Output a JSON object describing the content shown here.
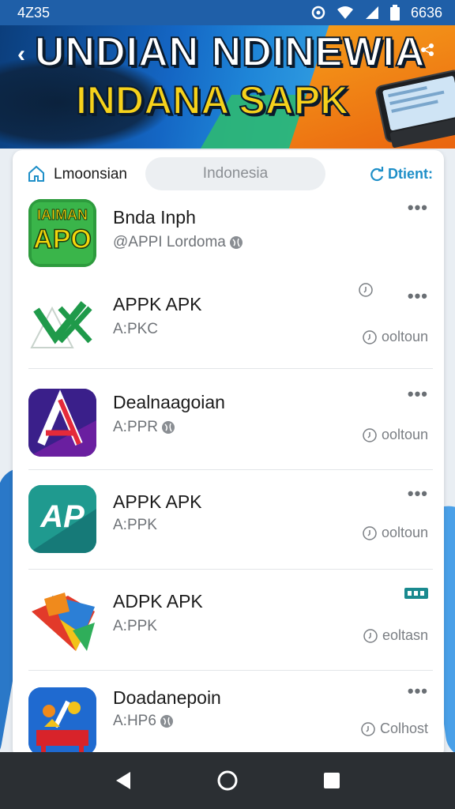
{
  "status_bar": {
    "time": "4Z35",
    "battery_text": "6636"
  },
  "banner": {
    "title_line1": "UNDIAN NDINEWIA",
    "title_line2": "INDANA SAPK"
  },
  "header": {
    "home_label": "Lmoonsian",
    "search_placeholder": "Indonesia",
    "right_label": "Dtient:"
  },
  "apps": [
    {
      "name": "Bnda Inph",
      "sub": "@APPI Lordoma",
      "meta": "",
      "icon_text_top": "IAIMAN",
      "icon_text_bottom": "APO"
    },
    {
      "name": "APPK APK",
      "sub": "A:PKC",
      "meta": "ooltoun"
    },
    {
      "name": "Dealnaagoian",
      "sub": "A:PPR",
      "meta": "ooltoun"
    },
    {
      "name": "APPK APK",
      "sub": "A:PPK",
      "meta": "ooltoun",
      "icon_text": "AP"
    },
    {
      "name": "ADPK APK",
      "sub": "A:PPK",
      "meta": "eoltasn"
    },
    {
      "name": "Doadanepoin",
      "sub": "A:HP6",
      "meta": "Colhost"
    }
  ],
  "colors": {
    "accent": "#1e8fc8",
    "banner_yellow": "#f6d21b",
    "nav_bg": "#2b2f33"
  },
  "icons": [
    "home-icon",
    "search-pill",
    "refresh-icon",
    "more-icon",
    "clock-icon",
    "globe-icon",
    "back-icon",
    "home-circle-icon",
    "recents-icon"
  ]
}
